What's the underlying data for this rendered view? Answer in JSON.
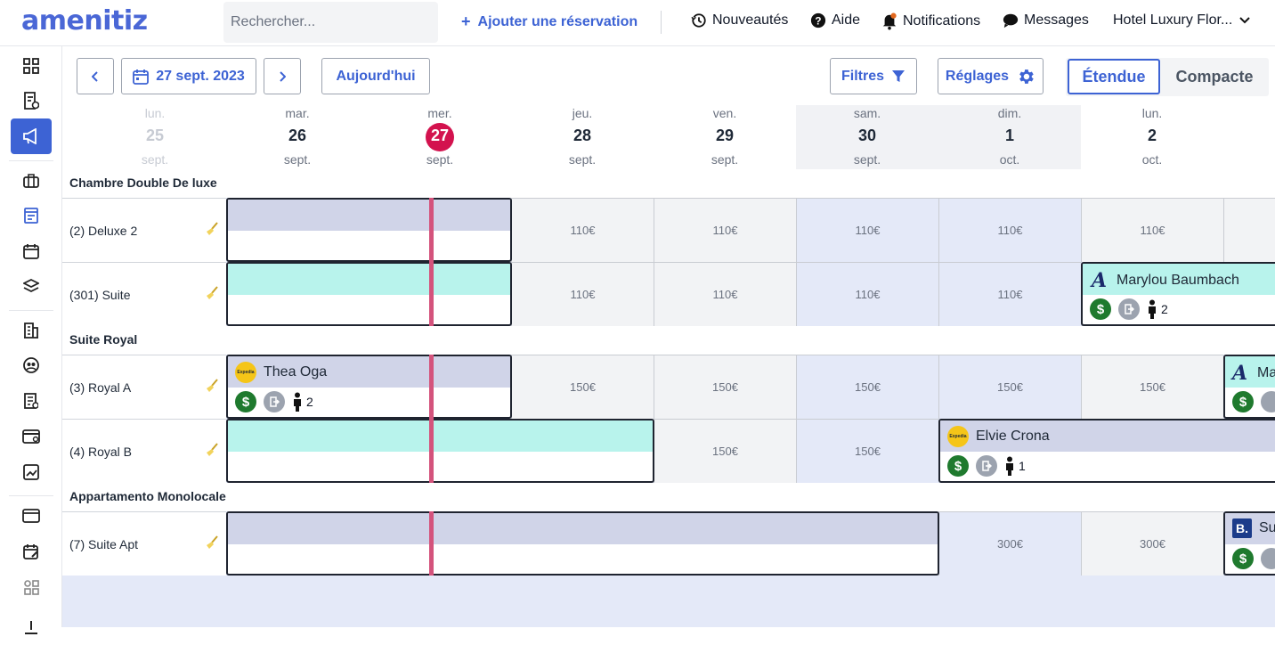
{
  "header": {
    "logo": "amenitiz",
    "search_placeholder": "Rechercher...",
    "add_reservation": "Ajouter une réservation",
    "nav": [
      {
        "label": "Nouveautés",
        "icon": "history-icon"
      },
      {
        "label": "Aide",
        "icon": "help-icon"
      },
      {
        "label": "Notifications",
        "icon": "bell-icon"
      },
      {
        "label": "Messages",
        "icon": "chat-icon"
      }
    ],
    "hotel": "Hotel Luxury Flor..."
  },
  "sidebar": {
    "items": [
      "dashboard-icon",
      "invoice-icon",
      "megaphone-icon",
      "briefcase-icon",
      "form-icon",
      "calendar-icon",
      "layers-icon",
      "building-icon",
      "users-icon",
      "receipt-icon",
      "card-icon",
      "chart-icon",
      "window-icon",
      "calendar-edit-icon",
      "apps-icon",
      "more-icon"
    ],
    "active_index": 2
  },
  "toolbar": {
    "date": "27 sept. 2023",
    "today": "Aujourd'hui",
    "filters": "Filtres",
    "settings": "Réglages",
    "view_extended": "Étendue",
    "view_compact": "Compacte"
  },
  "days": [
    {
      "dow": "lun.",
      "num": "25",
      "mon": "sept."
    },
    {
      "dow": "mar.",
      "num": "26",
      "mon": "sept."
    },
    {
      "dow": "mer.",
      "num": "27",
      "mon": "sept."
    },
    {
      "dow": "jeu.",
      "num": "28",
      "mon": "sept."
    },
    {
      "dow": "ven.",
      "num": "29",
      "mon": "sept."
    },
    {
      "dow": "sam.",
      "num": "30",
      "mon": "sept."
    },
    {
      "dow": "dim.",
      "num": "1",
      "mon": "oct."
    },
    {
      "dow": "lun.",
      "num": "2",
      "mon": "oct."
    }
  ],
  "categories": [
    "Chambre Double De luxe",
    "Suite Royal",
    "Appartamento Monolocale"
  ],
  "rooms": [
    {
      "label": "(2) Deluxe 2",
      "prices": [
        "110€",
        "110€",
        "110€",
        "110€",
        "110€"
      ]
    },
    {
      "label": "(301) Suite",
      "prices": [
        "110€",
        "110€",
        "110€",
        "110€"
      ]
    },
    {
      "label": "(3) Royal A",
      "prices": [
        "150€",
        "150€",
        "150€",
        "150€",
        "150€"
      ]
    },
    {
      "label": "(4) Royal B",
      "prices": [
        "150€",
        "150€"
      ]
    },
    {
      "label": "(7) Suite Apt",
      "prices": [
        "300€",
        "300€"
      ]
    }
  ],
  "bookings": [
    {
      "name": "Marylou Baumbach",
      "guests": "2"
    },
    {
      "name": "Thea Oga",
      "guests": "2"
    },
    {
      "name": "Ma"
    },
    {
      "name": "Elvie Crona",
      "guests": "1"
    },
    {
      "name": "Su"
    }
  ],
  "channel_labels": {
    "expedia": "Expedia",
    "booking": "B."
  },
  "colors": {
    "brand": "#3d63d4",
    "today": "#d3124e",
    "band_grey": "#d0d4e8",
    "band_teal": "#b8f3ec",
    "paid": "#1f7a2e"
  }
}
